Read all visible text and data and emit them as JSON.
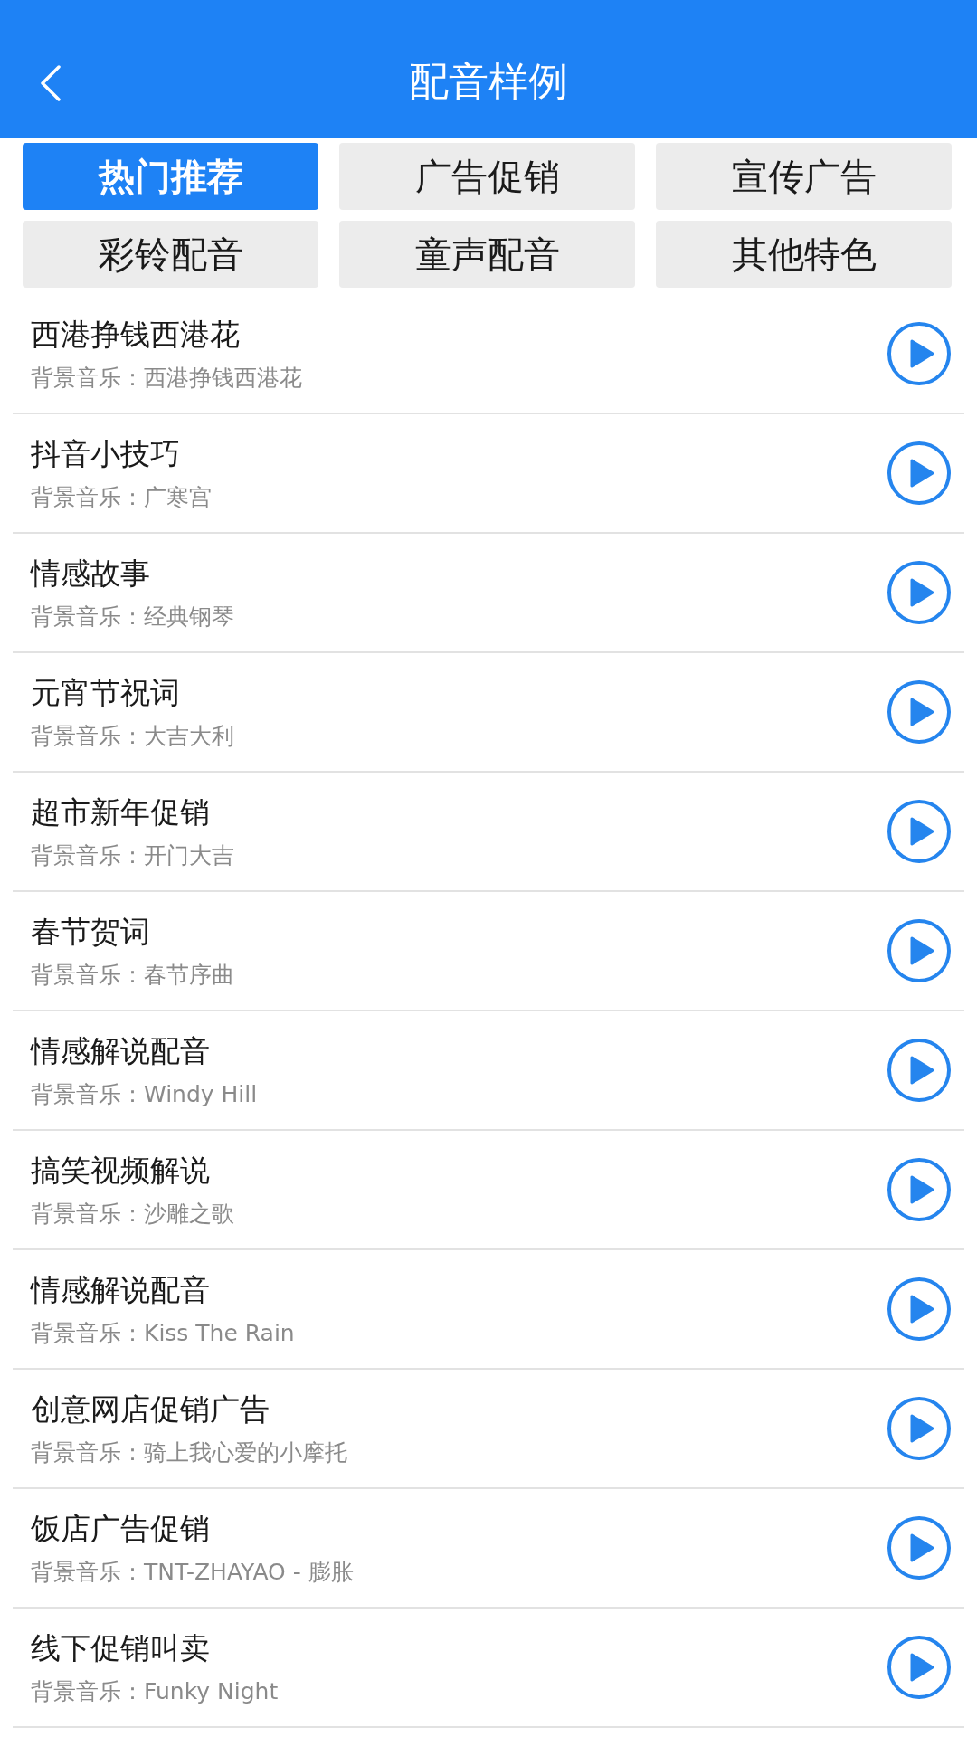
{
  "header": {
    "title": "配音样例"
  },
  "categories": [
    {
      "label": "热门推荐",
      "selected": true
    },
    {
      "label": "广告促销",
      "selected": false
    },
    {
      "label": "宣传广告",
      "selected": false
    },
    {
      "label": "彩铃配音",
      "selected": false
    },
    {
      "label": "童声配音",
      "selected": false
    },
    {
      "label": "其他特色",
      "selected": false
    }
  ],
  "samples": [
    {
      "title": "西港挣钱西港花",
      "music": "背景音乐：西港挣钱西港花"
    },
    {
      "title": "抖音小技巧",
      "music": "背景音乐：广寒宫"
    },
    {
      "title": "情感故事",
      "music": "背景音乐：经典钢琴"
    },
    {
      "title": "元宵节祝词",
      "music": "背景音乐：大吉大利"
    },
    {
      "title": "超市新年促销",
      "music": "背景音乐：开门大吉"
    },
    {
      "title": "春节贺词",
      "music": "背景音乐：春节序曲"
    },
    {
      "title": "情感解说配音",
      "music": "背景音乐：Windy Hill"
    },
    {
      "title": "搞笑视频解说",
      "music": "背景音乐：沙雕之歌"
    },
    {
      "title": "情感解说配音",
      "music": "背景音乐：Kiss The Rain"
    },
    {
      "title": "创意网店促销广告",
      "music": "背景音乐：骑上我心爱的小摩托"
    },
    {
      "title": "饭店广告促销",
      "music": "背景音乐：TNT-ZHAYAO - 膨胀"
    },
    {
      "title": "线下促销叫卖",
      "music": "背景音乐：Funky Night"
    }
  ]
}
